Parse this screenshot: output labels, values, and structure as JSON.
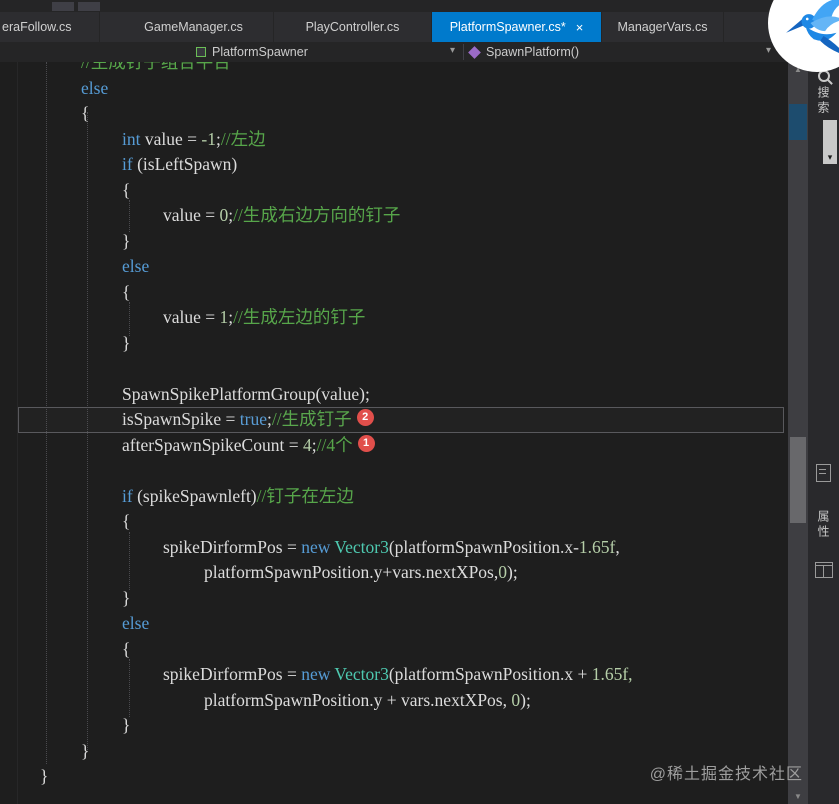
{
  "tabs": [
    {
      "label": "eraFollow.cs"
    },
    {
      "label": "GameManager.cs"
    },
    {
      "label": "PlayController.cs"
    },
    {
      "label": "PlatformSpawner.cs*",
      "active": true
    },
    {
      "label": "ManagerVars.cs"
    }
  ],
  "breadcrumb": {
    "class_name": "PlatformSpawner",
    "method_name": "SpawnPlatform()"
  },
  "icons": {
    "chevron_down": "▾",
    "close": "×",
    "scroll_up": "▲",
    "scroll_down": "▼",
    "rail_drop_arrow": "▾"
  },
  "side_panel": {
    "search_label": "搜索",
    "properties_label": "属性"
  },
  "watermark": "@稀土掘金技术社区",
  "colors": {
    "accent": "#007ACC",
    "editor_bg": "#1E1E1E",
    "keyword": "#569CD6",
    "comment": "#57A64A",
    "type": "#4EC9B0",
    "number": "#B5CEA8",
    "badge": "#E14F4B"
  },
  "code": {
    "lines": [
      {
        "i": 1,
        "t": [
          {
            "c": "cm",
            "s": "//生成钉子组合平台"
          }
        ]
      },
      {
        "i": 1,
        "t": [
          {
            "c": "kw",
            "s": "else"
          }
        ]
      },
      {
        "i": 1,
        "t": [
          {
            "c": "pl",
            "s": "{"
          }
        ]
      },
      {
        "i": 2,
        "t": [
          {
            "c": "kw",
            "s": "int "
          },
          {
            "c": "pl",
            "s": "value = "
          },
          {
            "c": "nm",
            "s": "-1"
          },
          {
            "c": "pl",
            "s": ";"
          },
          {
            "c": "cm",
            "s": "//左边"
          }
        ]
      },
      {
        "i": 2,
        "t": [
          {
            "c": "kw",
            "s": "if "
          },
          {
            "c": "pl",
            "s": "(isLeftSpawn)"
          }
        ]
      },
      {
        "i": 2,
        "t": [
          {
            "c": "pl",
            "s": "{"
          }
        ]
      },
      {
        "i": 3,
        "t": [
          {
            "c": "pl",
            "s": "value = "
          },
          {
            "c": "nm",
            "s": "0"
          },
          {
            "c": "pl",
            "s": ";"
          },
          {
            "c": "cm",
            "s": "//生成右边方向的钉子"
          }
        ]
      },
      {
        "i": 2,
        "t": [
          {
            "c": "pl",
            "s": "}"
          }
        ]
      },
      {
        "i": 2,
        "t": [
          {
            "c": "kw",
            "s": "else"
          }
        ]
      },
      {
        "i": 2,
        "t": [
          {
            "c": "pl",
            "s": "{"
          }
        ]
      },
      {
        "i": 3,
        "t": [
          {
            "c": "pl",
            "s": "value = "
          },
          {
            "c": "nm",
            "s": "1"
          },
          {
            "c": "pl",
            "s": ";"
          },
          {
            "c": "cm",
            "s": "//生成左边的钉子"
          }
        ]
      },
      {
        "i": 2,
        "t": [
          {
            "c": "pl",
            "s": "}"
          }
        ]
      },
      {
        "i": 0,
        "t": []
      },
      {
        "i": 2,
        "t": [
          {
            "c": "pl",
            "s": "SpawnSpikePlatformGroup(value);"
          }
        ]
      },
      {
        "i": 2,
        "hl": true,
        "badge": "2",
        "t": [
          {
            "c": "pl",
            "s": "isSpawnSpike = "
          },
          {
            "c": "kw",
            "s": "true"
          },
          {
            "c": "pl",
            "s": ";"
          },
          {
            "c": "cm",
            "s": "//生成钉子"
          }
        ]
      },
      {
        "i": 2,
        "badge": "1",
        "t": [
          {
            "c": "pl",
            "s": "afterSpawnSpikeCount = "
          },
          {
            "c": "nm",
            "s": "4"
          },
          {
            "c": "pl",
            "s": ";"
          },
          {
            "c": "cm",
            "s": "//4个"
          }
        ]
      },
      {
        "i": 0,
        "t": []
      },
      {
        "i": 2,
        "t": [
          {
            "c": "kw",
            "s": "if "
          },
          {
            "c": "pl",
            "s": "(spikeSpawnleft)"
          },
          {
            "c": "cm",
            "s": "//钉子在左边"
          }
        ]
      },
      {
        "i": 2,
        "t": [
          {
            "c": "pl",
            "s": "{"
          }
        ]
      },
      {
        "i": 3,
        "t": [
          {
            "c": "pl",
            "s": "spikeDirformPos = "
          },
          {
            "c": "kw",
            "s": "new "
          },
          {
            "c": "ty",
            "s": "Vector3"
          },
          {
            "c": "pl",
            "s": "(platformSpawnPosition.x-"
          },
          {
            "c": "nm",
            "s": "1.65f"
          },
          {
            "c": "pl",
            "s": ","
          }
        ]
      },
      {
        "i": 4,
        "t": [
          {
            "c": "pl",
            "s": "platformSpawnPosition.y+vars.nextXPos,"
          },
          {
            "c": "nm",
            "s": "0"
          },
          {
            "c": "pl",
            "s": ");"
          }
        ]
      },
      {
        "i": 2,
        "t": [
          {
            "c": "pl",
            "s": "}"
          }
        ]
      },
      {
        "i": 2,
        "t": [
          {
            "c": "kw",
            "s": "else"
          }
        ]
      },
      {
        "i": 2,
        "t": [
          {
            "c": "pl",
            "s": "{"
          }
        ]
      },
      {
        "i": 3,
        "t": [
          {
            "c": "pl",
            "s": "spikeDirformPos = "
          },
          {
            "c": "kw",
            "s": "new "
          },
          {
            "c": "ty",
            "s": "Vector3"
          },
          {
            "c": "pl",
            "s": "(platformSpawnPosition.x + "
          },
          {
            "c": "nm",
            "s": "1.65f,"
          }
        ]
      },
      {
        "i": 4,
        "t": [
          {
            "c": "pl",
            "s": "platformSpawnPosition.y + vars.nextXPos, "
          },
          {
            "c": "nm",
            "s": "0"
          },
          {
            "c": "pl",
            "s": ");"
          }
        ]
      },
      {
        "i": 2,
        "t": [
          {
            "c": "pl",
            "s": "}"
          }
        ]
      },
      {
        "i": 1,
        "t": [
          {
            "c": "pl",
            "s": "}"
          }
        ]
      },
      {
        "i": 0,
        "t": [
          {
            "c": "pl",
            "s": "}"
          }
        ]
      }
    ]
  }
}
